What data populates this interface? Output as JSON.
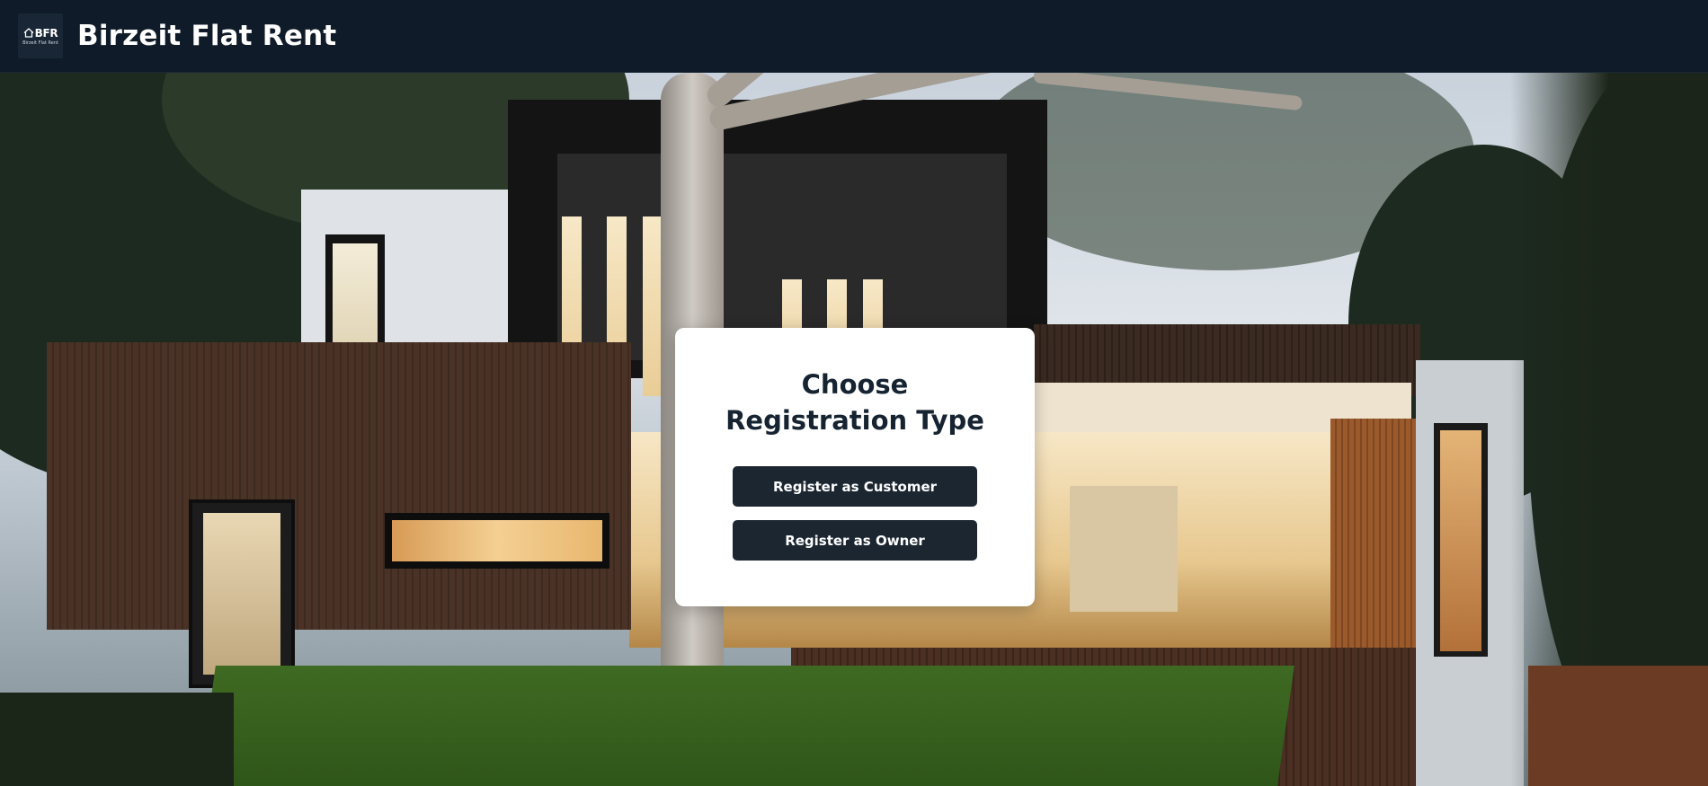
{
  "header": {
    "logo": {
      "abbr": "BFR",
      "subtitle": "Birzeit Flat Rent",
      "icon": "house-icon"
    },
    "title": "Birzeit Flat Rent"
  },
  "hero": {
    "image": "modern-house-photo"
  },
  "registration": {
    "title": "Choose Registration Type",
    "customer_button": "Register as Customer",
    "owner_button": "Register as Owner"
  },
  "colors": {
    "header_bg": "#0f1b28",
    "button_bg": "#1b2631",
    "card_bg": "#ffffff",
    "title_text": "#162331"
  }
}
